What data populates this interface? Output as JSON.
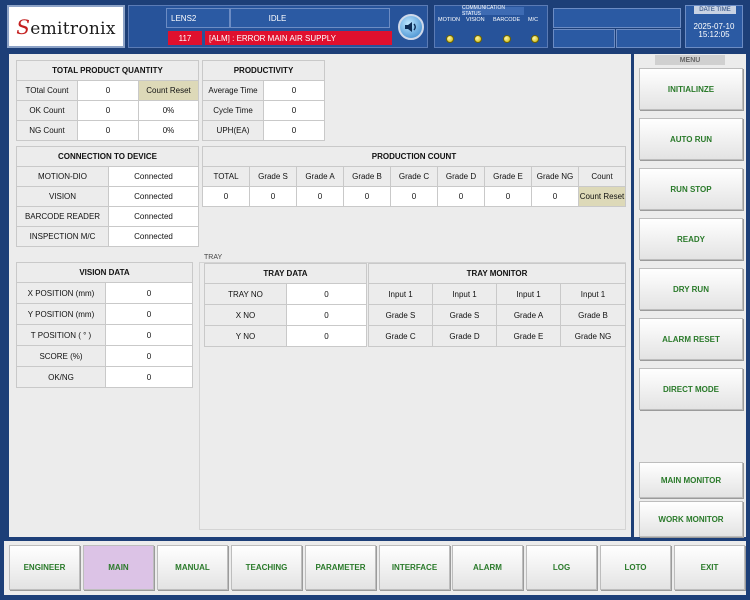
{
  "header": {
    "logo": "Semitronix",
    "model": "LENS2",
    "state": "IDLE",
    "alarm_code": "117",
    "alarm_message": "[ALM] : ERROR MAIN AIR SUPPLY",
    "comm_status": {
      "title": "COMMUNICATION STATUS",
      "labels": [
        "MOTION",
        "VISION",
        "BARCODE",
        "M/C"
      ]
    },
    "datetime": {
      "label": "DATE TIME",
      "date": "2025-07-10",
      "time": "15:12:05"
    }
  },
  "product_qty": {
    "title": "TOTAL PRODUCT QUANTITY",
    "rows": [
      {
        "label": "TOtal Count",
        "value": "0",
        "extra": "Count Reset"
      },
      {
        "label": "OK Count",
        "value": "0",
        "extra": "0%"
      },
      {
        "label": "NG Count",
        "value": "0",
        "extra": "0%"
      }
    ]
  },
  "productivity": {
    "title": "PRODUCTIVITY",
    "rows": [
      {
        "label": "Average Time",
        "value": "0"
      },
      {
        "label": "Cycle Time",
        "value": "0"
      },
      {
        "label": "UPH(EA)",
        "value": "0"
      }
    ]
  },
  "connection": {
    "title": "CONNECTION TO DEVICE",
    "rows": [
      {
        "label": "MOTION-DIO",
        "value": "Connected"
      },
      {
        "label": "VISION",
        "value": "Connected"
      },
      {
        "label": "BARCODE READER",
        "value": "Connected"
      },
      {
        "label": "INSPECTION M/C",
        "value": "Connected"
      }
    ]
  },
  "production_count": {
    "title": "PRODUCTION COUNT",
    "headers": [
      "TOTAL",
      "Grade S",
      "Grade A",
      "Grade B",
      "Grade C",
      "Grade D",
      "Grade E",
      "Grade NG",
      "Count"
    ],
    "values": [
      "0",
      "0",
      "0",
      "0",
      "0",
      "0",
      "0",
      "0",
      "Count Reset"
    ]
  },
  "vision_data": {
    "title": "VISION DATA",
    "rows": [
      {
        "label": "X POSITION (mm)",
        "value": "0"
      },
      {
        "label": "Y POSITION (mm)",
        "value": "0"
      },
      {
        "label": "T POSITION ( ° )",
        "value": "0"
      },
      {
        "label": "SCORE (%)",
        "value": "0"
      },
      {
        "label": "OK/NG",
        "value": "0"
      }
    ]
  },
  "tray": {
    "group_label": "TRAY",
    "data_title": "TRAY DATA",
    "data_rows": [
      {
        "label": "TRAY NO",
        "value": "0"
      },
      {
        "label": "X NO",
        "value": "0"
      },
      {
        "label": "Y NO",
        "value": "0"
      }
    ],
    "monitor_title": "TRAY MONITOR",
    "monitor_rows": [
      [
        "Input 1",
        "Input 1",
        "Input 1",
        "Input 1"
      ],
      [
        "Grade S",
        "Grade S",
        "Grade A",
        "Grade B"
      ],
      [
        "Grade C",
        "Grade D",
        "Grade E",
        "Grade NG"
      ]
    ]
  },
  "menu": {
    "title": "MENU",
    "items": [
      "INITIALINZE",
      "AUTO RUN",
      "RUN STOP",
      "READY",
      "DRY RUN",
      "ALARM RESET",
      "DIRECT MODE",
      "MAIN MONITOR",
      "WORK MONITOR"
    ]
  },
  "nav": {
    "active": "MAIN",
    "items": [
      "ENGINEER",
      "MAIN",
      "MANUAL",
      "TEACHING",
      "PARAMETER",
      "INTERFACE",
      "ALARM",
      "LOG",
      "LOTO",
      "EXIT"
    ]
  },
  "colors": {
    "frame": "#1d3f78",
    "alarm": "#e0102e",
    "button_text": "#2a7a2a",
    "active_tab": "#dcc3e6",
    "reset_button": "#ddd9b8"
  }
}
